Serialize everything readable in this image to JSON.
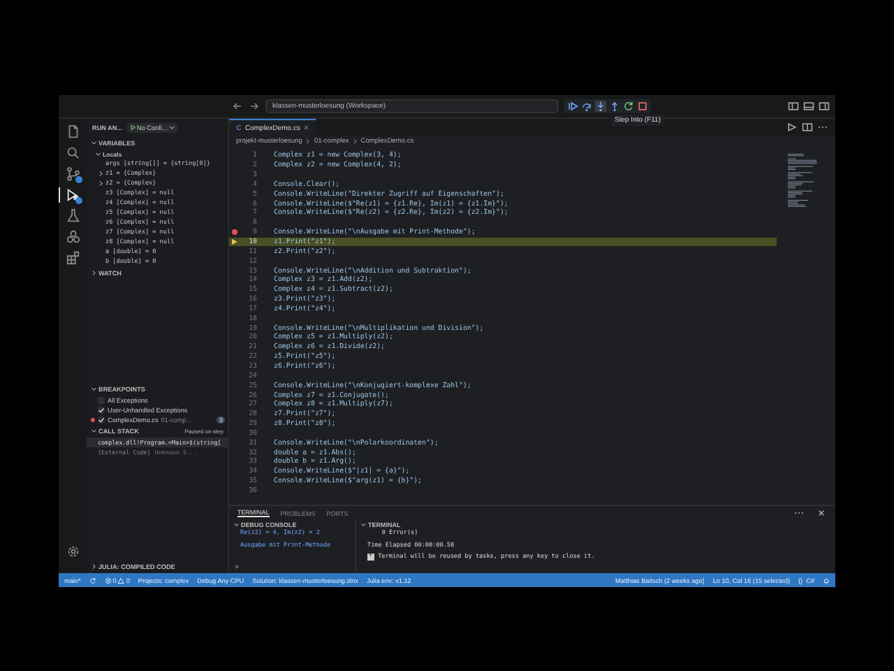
{
  "window": {
    "title": "klassen-musterloesung (Workspace)"
  },
  "debug_toolbar": {
    "tooltip": "Step Into (F11)"
  },
  "activity_bar": [
    {
      "kind": "files",
      "selected": false,
      "badge": false
    },
    {
      "kind": "search",
      "selected": false,
      "badge": false
    },
    {
      "kind": "git",
      "selected": false,
      "badge": true
    },
    {
      "kind": "debug",
      "selected": true,
      "badge": true
    },
    {
      "kind": "flask",
      "selected": false,
      "badge": false
    },
    {
      "kind": "circles",
      "selected": false,
      "badge": false
    },
    {
      "kind": "extensions",
      "selected": false,
      "badge": false
    },
    {
      "kind": "gear",
      "selected": false,
      "badge": false
    }
  ],
  "sidebar": {
    "title": "RUN AN...",
    "config": "No Confi...",
    "variables_header": {
      "label": "VARIABLES",
      "expanded": true
    },
    "locals_header": {
      "label": "Locals",
      "expanded": true
    },
    "variables": [
      {
        "text": "args [string[]] = {string[0]}",
        "expandable": false
      },
      {
        "text": "z1 = {Complex}",
        "expandable": true
      },
      {
        "text": "z2 = {Complex}",
        "expandable": true
      },
      {
        "text": "z3 [Complex] = null",
        "expandable": false
      },
      {
        "text": "z4 [Complex] = null",
        "expandable": false
      },
      {
        "text": "z5 [Complex] = null",
        "expandable": false
      },
      {
        "text": "z6 [Complex] = null",
        "expandable": false
      },
      {
        "text": "z7 [Complex] = null",
        "expandable": false
      },
      {
        "text": "z8 [Complex] = null",
        "expandable": false
      },
      {
        "text": "a [double] = 0",
        "expandable": false
      },
      {
        "text": "b [double] = 0",
        "expandable": false
      }
    ],
    "watch_header": {
      "label": "WATCH",
      "expanded": false
    },
    "breakpoints_header": {
      "label": "BREAKPOINTS",
      "expanded": true
    },
    "breakpoints": [
      {
        "label": "All Exceptions",
        "checked": false
      },
      {
        "label": "User-Unhandled Exceptions",
        "checked": true
      },
      {
        "label": "ComplexDemo.cs",
        "detail": "01-comp...",
        "count": "9",
        "checked": true
      }
    ],
    "call_stack_header": {
      "label": "CALL STACK",
      "expanded": true
    },
    "call_stack_state": "Paused on step",
    "call_stack": [
      {
        "frame": "complex.dll!Program.<Main>$(string[",
        "selected": true
      },
      {
        "frame": "[External Code]",
        "detail": "Unknown S...",
        "selected": false
      }
    ],
    "julia_header": {
      "label": "JULIA: COMPILED CODE",
      "expanded": false
    }
  },
  "editor": {
    "tab": "ComplexDemo.cs",
    "breadcrumbs": [
      "projekt-musterloesung",
      "01-complex",
      "ComplexDemo.cs"
    ],
    "lines": [
      {
        "n": "1",
        "text": "Complex z1 = new Complex(3, 4);",
        "breakpoint": false,
        "current": false
      },
      {
        "n": "2",
        "text": "Complex z2 = new Complex(4, 2);",
        "breakpoint": false,
        "current": false
      },
      {
        "n": "3",
        "breakpoint": false,
        "current": false
      },
      {
        "n": "4",
        "text": "Console.Clear();",
        "breakpoint": false,
        "current": false
      },
      {
        "n": "5",
        "text": "Console.WriteLine(\"Direkter Zugriff auf Eigenschaften\");",
        "breakpoint": false,
        "current": false
      },
      {
        "n": "6",
        "text": "Console.WriteLine($\"Re(z1) = {z1.Re}, Im(z1) = {z1.Im}\");",
        "breakpoint": false,
        "current": false
      },
      {
        "n": "7",
        "text": "Console.WriteLine($\"Re(z2) = {z2.Re}, Im(z2) = {z2.Im}\");",
        "breakpoint": false,
        "current": false
      },
      {
        "n": "8",
        "breakpoint": false,
        "current": false
      },
      {
        "n": "9",
        "text": "Console.WriteLine(\"\\nAusgabe mit Print-Methode\");",
        "breakpoint": true,
        "current": false
      },
      {
        "n": "10",
        "text": "z1.Print(\"z1\");",
        "breakpoint": false,
        "current": true
      },
      {
        "n": "11",
        "text": "z2.Print(\"z2\");",
        "breakpoint": false,
        "current": false
      },
      {
        "n": "12",
        "breakpoint": false,
        "current": false
      },
      {
        "n": "13",
        "text": "Console.WriteLine(\"\\nAddition und Subtraktion\");",
        "breakpoint": false,
        "current": false
      },
      {
        "n": "14",
        "text": "Complex z3 = z1.Add(z2);",
        "breakpoint": false,
        "current": false
      },
      {
        "n": "15",
        "text": "Complex z4 = z1.Subtract(z2);",
        "breakpoint": false,
        "current": false
      },
      {
        "n": "16",
        "text": "z3.Print(\"z3\");",
        "breakpoint": false,
        "current": false
      },
      {
        "n": "17",
        "text": "z4.Print(\"z4\");",
        "breakpoint": false,
        "current": false
      },
      {
        "n": "18",
        "breakpoint": false,
        "current": false
      },
      {
        "n": "19",
        "text": "Console.WriteLine(\"\\nMultiplikation und Division\");",
        "breakpoint": false,
        "current": false
      },
      {
        "n": "20",
        "text": "Complex z5 = z1.Multiply(z2);",
        "breakpoint": false,
        "current": false
      },
      {
        "n": "21",
        "text": "Complex z6 = z1.Divide(z2);",
        "breakpoint": false,
        "current": false
      },
      {
        "n": "22",
        "text": "z5.Print(\"z5\");",
        "breakpoint": false,
        "current": false
      },
      {
        "n": "23",
        "text": "z6.Print(\"z6\");",
        "breakpoint": false,
        "current": false
      },
      {
        "n": "24",
        "breakpoint": false,
        "current": false
      },
      {
        "n": "25",
        "text": "Console.WriteLine(\"\\nKonjugiert-komplexe Zahl\");",
        "breakpoint": false,
        "current": false
      },
      {
        "n": "26",
        "text": "Complex z7 = z1.Conjugate();",
        "breakpoint": false,
        "current": false
      },
      {
        "n": "27",
        "text": "Complex z8 = z1.Multiply(z7);",
        "breakpoint": false,
        "current": false
      },
      {
        "n": "28",
        "text": "z7.Print(\"z7\");",
        "breakpoint": false,
        "current": false
      },
      {
        "n": "29",
        "text": "z8.Print(\"z8\");",
        "breakpoint": false,
        "current": false
      },
      {
        "n": "30",
        "breakpoint": false,
        "current": false
      },
      {
        "n": "31",
        "text": "Console.WriteLine(\"\\nPolarkoordinaten\");",
        "breakpoint": false,
        "current": false
      },
      {
        "n": "32",
        "text": "double a = z1.Abs();",
        "breakpoint": false,
        "current": false
      },
      {
        "n": "33",
        "text": "double b = z1.Arg();",
        "breakpoint": false,
        "current": false
      },
      {
        "n": "34",
        "text": "Console.WriteLine($\"|z1| = {a}\");",
        "breakpoint": false,
        "current": false
      },
      {
        "n": "35",
        "text": "Console.WriteLine($\"arg(z1) = {b}\");",
        "breakpoint": false,
        "current": false
      },
      {
        "n": "36",
        "breakpoint": false,
        "current": false
      }
    ]
  },
  "panel": {
    "tabs": [
      {
        "label": "TERMINAL",
        "selected": true
      },
      {
        "label": "PROBLEMS",
        "selected": false
      },
      {
        "label": "PORTS",
        "selected": false
      }
    ],
    "debug_console": {
      "header": {
        "label": "DEBUG CONSOLE",
        "expanded": true
      },
      "lines": [
        "Re(z2) = 4, Im(z2) = 2",
        "Ausgabe mit Print-Methode"
      ],
      "prompt": ">"
    },
    "terminal": {
      "header": {
        "label": "TERMINAL",
        "expanded": true
      },
      "lines": [
        "    0 Error(s)",
        "Time Elapsed 00:00:00.58"
      ],
      "notice_mark": "*",
      "notice": "Terminal will be reused by tasks, press any key to close it."
    }
  },
  "status_bar": {
    "left": [
      "main*",
      "Projects: complex",
      "Debug Any CPU",
      "Solution: klassen-musterloesung.slnx",
      "Julia env: v1.12"
    ],
    "errors": "0",
    "warnings": "0",
    "right": [
      "Matthias Baitsch (2 weeks ago)",
      "Ln 10, Col 16 (15 selected)",
      "{}  C#"
    ]
  }
}
